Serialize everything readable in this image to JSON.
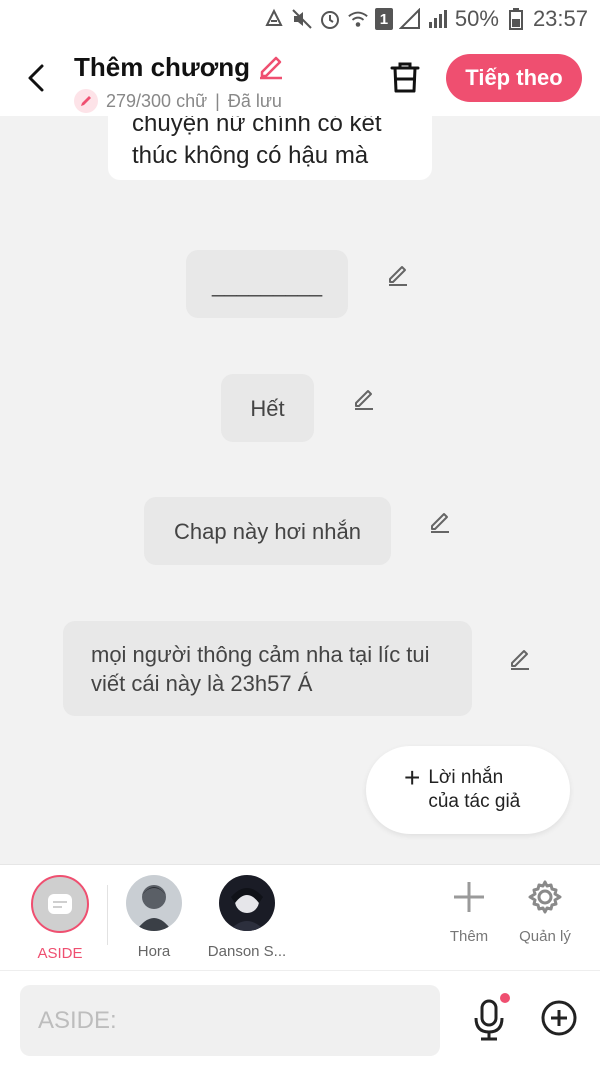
{
  "status_bar": {
    "icons": [
      "recycle-icon",
      "mute-icon",
      "alarm-icon",
      "wifi-icon",
      "sim-1-icon",
      "signal-icon",
      "signal-icon",
      "battery-icon"
    ],
    "sim_label": "1",
    "battery": "50%",
    "time": "23:57"
  },
  "header": {
    "title": "Thêm chương",
    "word_count": "279/300 chữ",
    "separator": "|",
    "save_status": "Đã lưu",
    "next_label": "Tiếp theo",
    "accent_color": "#ef4f70"
  },
  "messages": [
    {
      "text": "chuyện nữ chính có kết thúc không có hậu mà"
    },
    {
      "text": "_________"
    },
    {
      "text": "Hết"
    },
    {
      "text": "Chap này hơi nhắn"
    },
    {
      "text": "mọi người thông cảm nha tại líc tui viết cái này là 23h57 Á"
    }
  ],
  "author_note": {
    "plus": "+",
    "label_line1": "Lời nhắn",
    "label_line2": "của tác giả"
  },
  "characters": [
    {
      "name": "ASIDE",
      "selected": true
    },
    {
      "name": "Hora",
      "selected": false
    },
    {
      "name": "Danson S..."
    }
  ],
  "tools": {
    "add_label": "Thêm",
    "manage_label": "Quản lý"
  },
  "input": {
    "placeholder": "ASIDE:",
    "value": ""
  }
}
